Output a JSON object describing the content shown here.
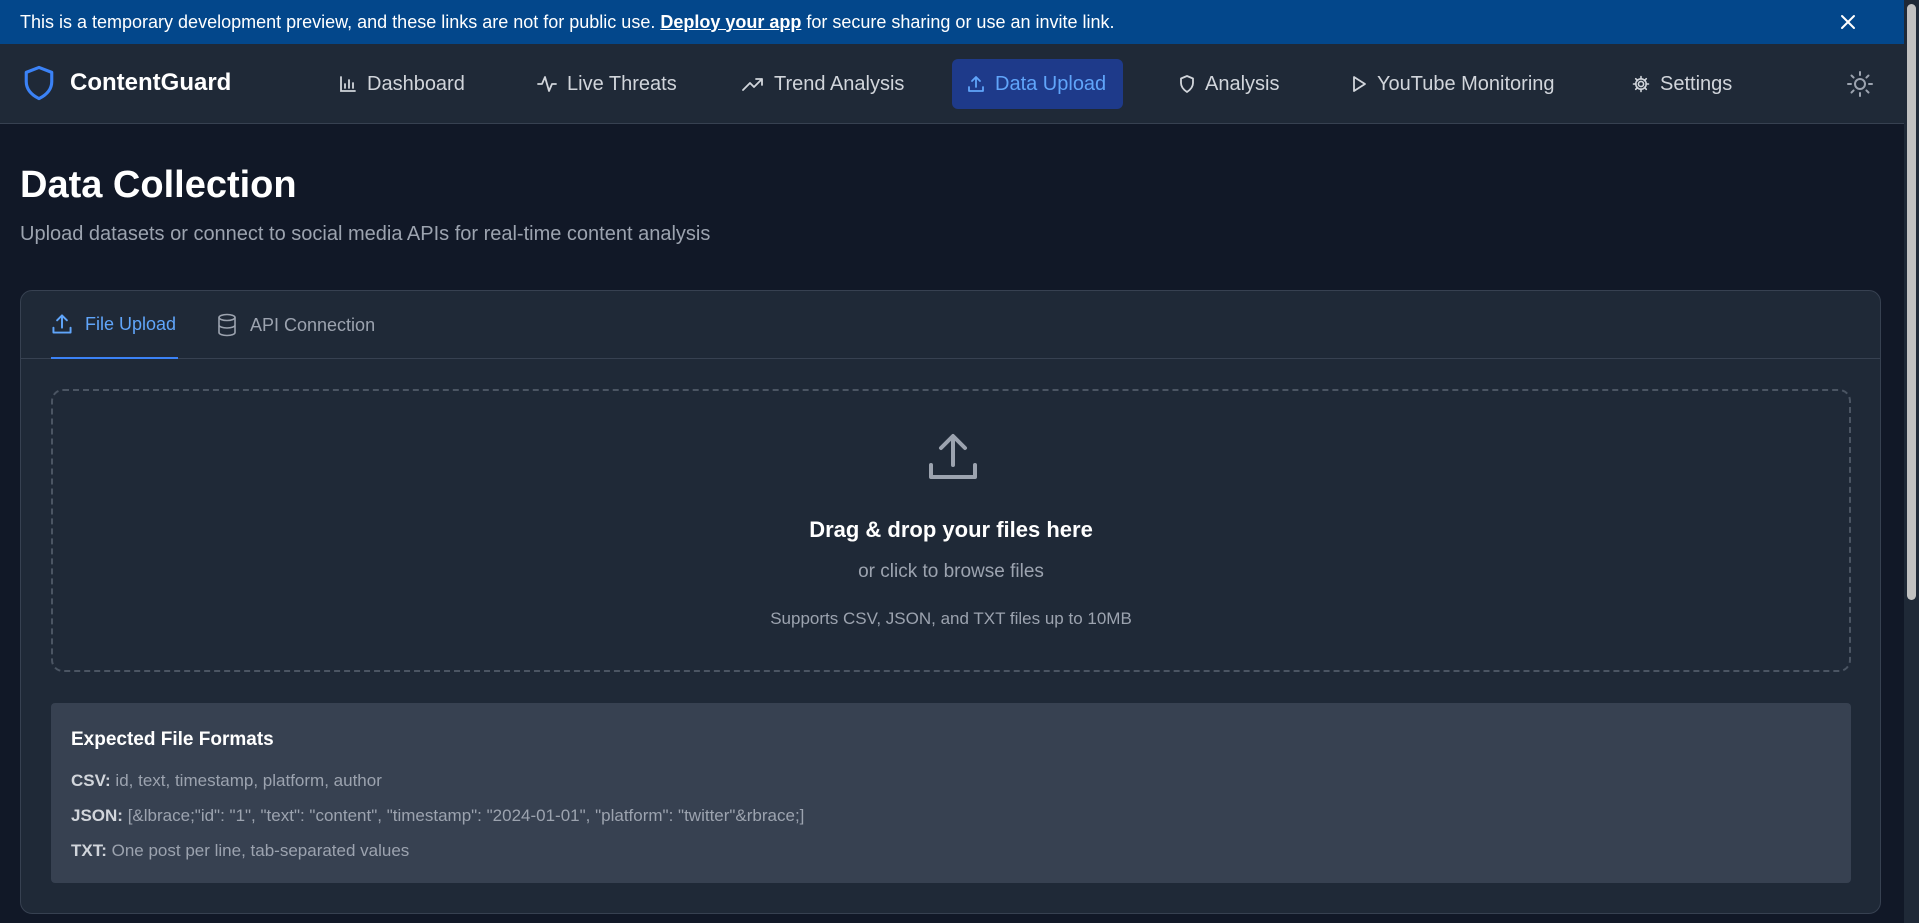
{
  "banner": {
    "text_before": "This is a temporary development preview, and these links are not for public use.",
    "link": "Deploy your app",
    "text_after": "for secure sharing or use an invite link."
  },
  "brand": {
    "name": "ContentGuard"
  },
  "nav": {
    "items": [
      {
        "label": "Dashboard",
        "icon": "bar-chart-icon"
      },
      {
        "label": "Live Threats",
        "icon": "activity-icon"
      },
      {
        "label": "Trend Analysis",
        "icon": "trending-up-icon"
      },
      {
        "label": "Data Upload",
        "icon": "upload-icon",
        "active": true
      },
      {
        "label": "Analysis",
        "icon": "shield-icon"
      },
      {
        "label": "YouTube Monitoring",
        "icon": "play-icon"
      },
      {
        "label": "Settings",
        "icon": "gear-icon"
      }
    ]
  },
  "page": {
    "title": "Data Collection",
    "subtitle": "Upload datasets or connect to social media APIs for real-time content analysis"
  },
  "tabs": [
    {
      "label": "File Upload",
      "icon": "upload-icon",
      "active": true
    },
    {
      "label": "API Connection",
      "icon": "database-icon",
      "active": false
    }
  ],
  "dropzone": {
    "title": "Drag & drop your files here",
    "subtitle": "or click to browse files",
    "note": "Supports CSV, JSON, and TXT files up to 10MB"
  },
  "formats": {
    "title": "Expected File Formats",
    "items": [
      {
        "label": "CSV:",
        "desc": "id, text, timestamp, platform, author"
      },
      {
        "label": "JSON:",
        "desc": "[&lbrace;\"id\": \"1\", \"text\": \"content\", \"timestamp\": \"2024-01-01\", \"platform\": \"twitter\"&rbrace;]"
      },
      {
        "label": "TXT:",
        "desc": "One post per line, tab-separated values"
      }
    ]
  },
  "colors": {
    "banner": "#03478b",
    "background": "#111827",
    "surface": "#1f2937",
    "accent": "#60a5fa",
    "active_nav_bg": "#1e3a8a"
  }
}
